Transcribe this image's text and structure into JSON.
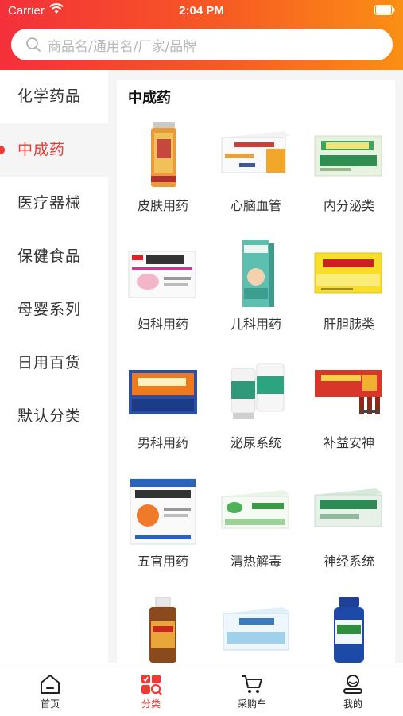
{
  "status": {
    "carrier": "Carrier",
    "time": "2:04 PM"
  },
  "search": {
    "placeholder": "商品名/通用名/厂家/品牌"
  },
  "sidebar": {
    "items": [
      {
        "label": "化学药品",
        "active": false
      },
      {
        "label": "中成药",
        "active": true
      },
      {
        "label": "医疗器械",
        "active": false
      },
      {
        "label": "保健食品",
        "active": false
      },
      {
        "label": "母婴系列",
        "active": false
      },
      {
        "label": "日用百货",
        "active": false
      },
      {
        "label": "默认分类",
        "active": false
      }
    ]
  },
  "content": {
    "title": "中成药",
    "subcategories": [
      {
        "label": "皮肤用药",
        "icon": "skin-medicine-bottle"
      },
      {
        "label": "心脑血管",
        "icon": "cardio-capsule-box"
      },
      {
        "label": "内分泌类",
        "icon": "endocrine-box"
      },
      {
        "label": "妇科用药",
        "icon": "gynecology-suppository-box"
      },
      {
        "label": "儿科用药",
        "icon": "pediatric-syrup-box"
      },
      {
        "label": "肝胆胰类",
        "icon": "liver-tablet-box"
      },
      {
        "label": "男科用药",
        "icon": "andrology-tablet-box"
      },
      {
        "label": "泌尿系统",
        "icon": "urinary-bottles"
      },
      {
        "label": "补益安神",
        "icon": "tonic-oral-liquid-box"
      },
      {
        "label": "五官用药",
        "icon": "ent-granule-box"
      },
      {
        "label": "清热解毒",
        "icon": "heat-clearing-tablet-box"
      },
      {
        "label": "神经系统",
        "icon": "nerve-capsule-box"
      },
      {
        "label": "",
        "icon": "tincture-bottle"
      },
      {
        "label": "",
        "icon": "oral-liquid-box"
      },
      {
        "label": "",
        "icon": "supplement-bottle"
      }
    ]
  },
  "tabbar": {
    "items": [
      {
        "label": "首页",
        "icon": "home-icon",
        "active": false
      },
      {
        "label": "分类",
        "icon": "category-icon",
        "active": true
      },
      {
        "label": "采购车",
        "icon": "cart-icon",
        "active": false
      },
      {
        "label": "我的",
        "icon": "profile-icon",
        "active": false
      }
    ]
  },
  "colors": {
    "accent": "#ef3a34",
    "header_start": "#f4303a",
    "header_end": "#fb8f14"
  }
}
